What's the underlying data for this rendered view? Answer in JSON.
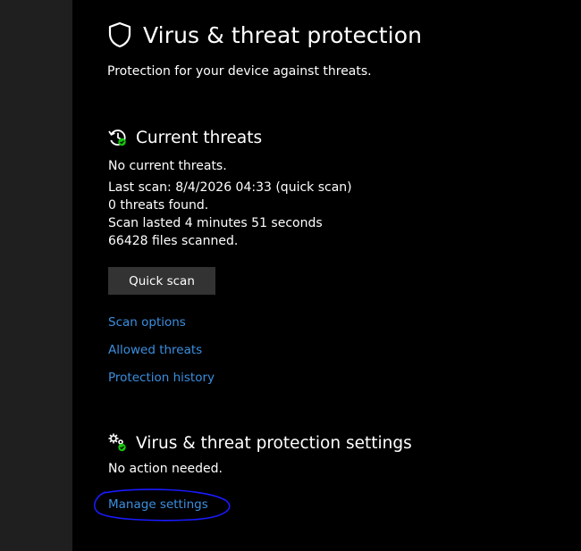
{
  "header": {
    "title": "Virus & threat protection",
    "subtitle": "Protection for your device against threats."
  },
  "current_threats": {
    "title": "Current threats",
    "status": "No current threats.",
    "details": [
      "Last scan: 8/4/2026 04:33 (quick scan)",
      "0 threats found.",
      "Scan lasted 4 minutes 51 seconds",
      "66428 files scanned."
    ],
    "quick_scan_label": "Quick scan",
    "links": {
      "scan_options": "Scan options",
      "allowed_threats": "Allowed threats",
      "protection_history": "Protection history"
    }
  },
  "settings": {
    "title": "Virus & threat protection settings",
    "status": "No action needed.",
    "manage_link": "Manage settings"
  },
  "colors": {
    "background": "#000000",
    "left_rail": "#1f1f1f",
    "link": "#3b8fe0",
    "button": "#333333",
    "ok_badge": "#16c60c",
    "annotation": "#1a1aff"
  },
  "icons": {
    "header": "shield-icon",
    "current_threats": "history-clock-check-icon",
    "settings": "gears-check-icon"
  }
}
